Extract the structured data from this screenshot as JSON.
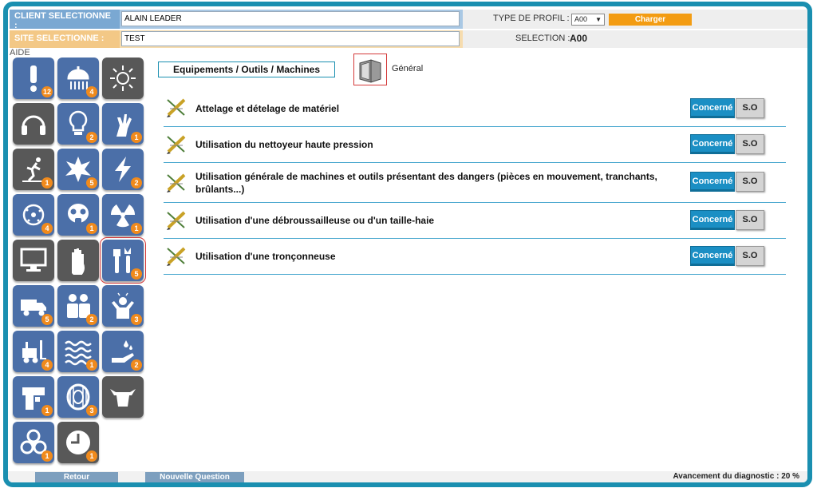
{
  "header": {
    "client_label": "CLIENT SELECTIONNE :",
    "client_value": "ALAIN LEADER",
    "site_label": "SITE SELECTIONNE :",
    "site_value": "TEST",
    "profil_label": "TYPE DE PROFIL :",
    "profil_value": "A00",
    "charger_label": "Charger",
    "selection_label": "SELECTION :",
    "selection_value": "A00"
  },
  "aide_label": "AIDE",
  "categories": [
    {
      "icon": "exclamation-icon",
      "badge": "12"
    },
    {
      "icon": "shower-icon",
      "badge": "4"
    },
    {
      "icon": "sun-icon",
      "badge": ""
    },
    {
      "icon": "headphones-icon",
      "badge": ""
    },
    {
      "icon": "lightbulb-icon",
      "badge": "2"
    },
    {
      "icon": "hand-chemical-icon",
      "badge": "1"
    },
    {
      "icon": "fall-icon",
      "badge": "1"
    },
    {
      "icon": "explosion-icon",
      "badge": "5"
    },
    {
      "icon": "lightning-icon",
      "badge": "2"
    },
    {
      "icon": "biohazard-spray-icon",
      "badge": "4"
    },
    {
      "icon": "gas-mask-icon",
      "badge": "1"
    },
    {
      "icon": "radiation-icon",
      "badge": "1"
    },
    {
      "icon": "monitor-icon",
      "badge": ""
    },
    {
      "icon": "hand-stop-icon",
      "badge": ""
    },
    {
      "icon": "tools-icon",
      "badge": "5"
    },
    {
      "icon": "truck-icon",
      "badge": "5"
    },
    {
      "icon": "people-icon",
      "badge": "2"
    },
    {
      "icon": "stress-icon",
      "badge": "3"
    },
    {
      "icon": "forklift-icon",
      "badge": "4"
    },
    {
      "icon": "waves-icon",
      "badge": "1"
    },
    {
      "icon": "hand-drop-icon",
      "badge": "2"
    },
    {
      "icon": "worker-icon",
      "badge": "1"
    },
    {
      "icon": "cable-drum-icon",
      "badge": "3"
    },
    {
      "icon": "cow-icon",
      "badge": ""
    },
    {
      "icon": "biohazard-icon",
      "badge": "1"
    },
    {
      "icon": "clock-icon",
      "badge": "1"
    }
  ],
  "main": {
    "category_title": "Equipements / Outils / Machines",
    "folder_label": "Général",
    "items": [
      {
        "text": "Attelage et dételage de matériel"
      },
      {
        "text": "Utilisation du nettoyeur haute pression"
      },
      {
        "text": "Utilisation générale de machines et outils présentant des dangers (pièces en mouvement, tranchants, brûlants...)"
      },
      {
        "text": "Utilisation d'une débroussailleuse ou d'un taille-haie"
      },
      {
        "text": "Utilisation d'une tronçonneuse"
      }
    ],
    "btn_concerne": "Concerné",
    "btn_so": "S.O"
  },
  "footer": {
    "retour": "Retour",
    "nouvelle_question": "Nouvelle Question",
    "avancement": "Avancement du diagnostic : 20 %"
  },
  "colors": {
    "frame": "#1a8fb0",
    "tile_blue": "#4b6fa8",
    "tile_dark": "#585858",
    "badge": "#f08a1c",
    "concerne": "#1b8fc4",
    "charger": "#f39c12"
  }
}
